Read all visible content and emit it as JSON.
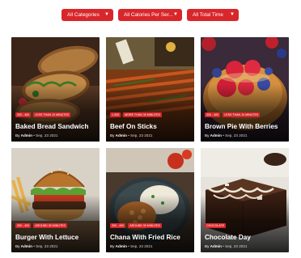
{
  "filters": [
    {
      "label": "All Categories"
    },
    {
      "label": "All Calories Per Ser..."
    },
    {
      "label": "All Total Time"
    }
  ],
  "colors": {
    "accent": "#d9262b"
  },
  "cards": [
    {
      "title": "Baked Bread Sandwich",
      "tags": [
        "300 - 400",
        "Less Than 10 Minutes"
      ],
      "by": "By",
      "author": "Admin",
      "date": "Sep, 23 2021"
    },
    {
      "title": "Beef On Sticks",
      "tags": [
        "1-300",
        "More Than 30 Minutes"
      ],
      "by": "By",
      "author": "Admin",
      "date": "Sep, 23 2021"
    },
    {
      "title": "Brown Pie With Berries",
      "tags": [
        "300 - 400",
        "Less Than 10 Minutes"
      ],
      "by": "By",
      "author": "Admin",
      "date": "Sep, 23 2021"
    },
    {
      "title": "Burger With Lettuce",
      "tags": [
        "300 - 400",
        "Around 30 Minutes"
      ],
      "by": "By",
      "author": "Admin",
      "date": "Sep, 23 2021"
    },
    {
      "title": "Chana With Fried Rice",
      "tags": [
        "300 - 400",
        "Around 30 Minutes"
      ],
      "by": "By",
      "author": "Admin",
      "date": "Sep, 23 2021"
    },
    {
      "title": "Chocolate Day",
      "tags": [
        "Chocolate"
      ],
      "by": "By",
      "author": "Admin",
      "date": "Sep, 23 2021"
    }
  ]
}
